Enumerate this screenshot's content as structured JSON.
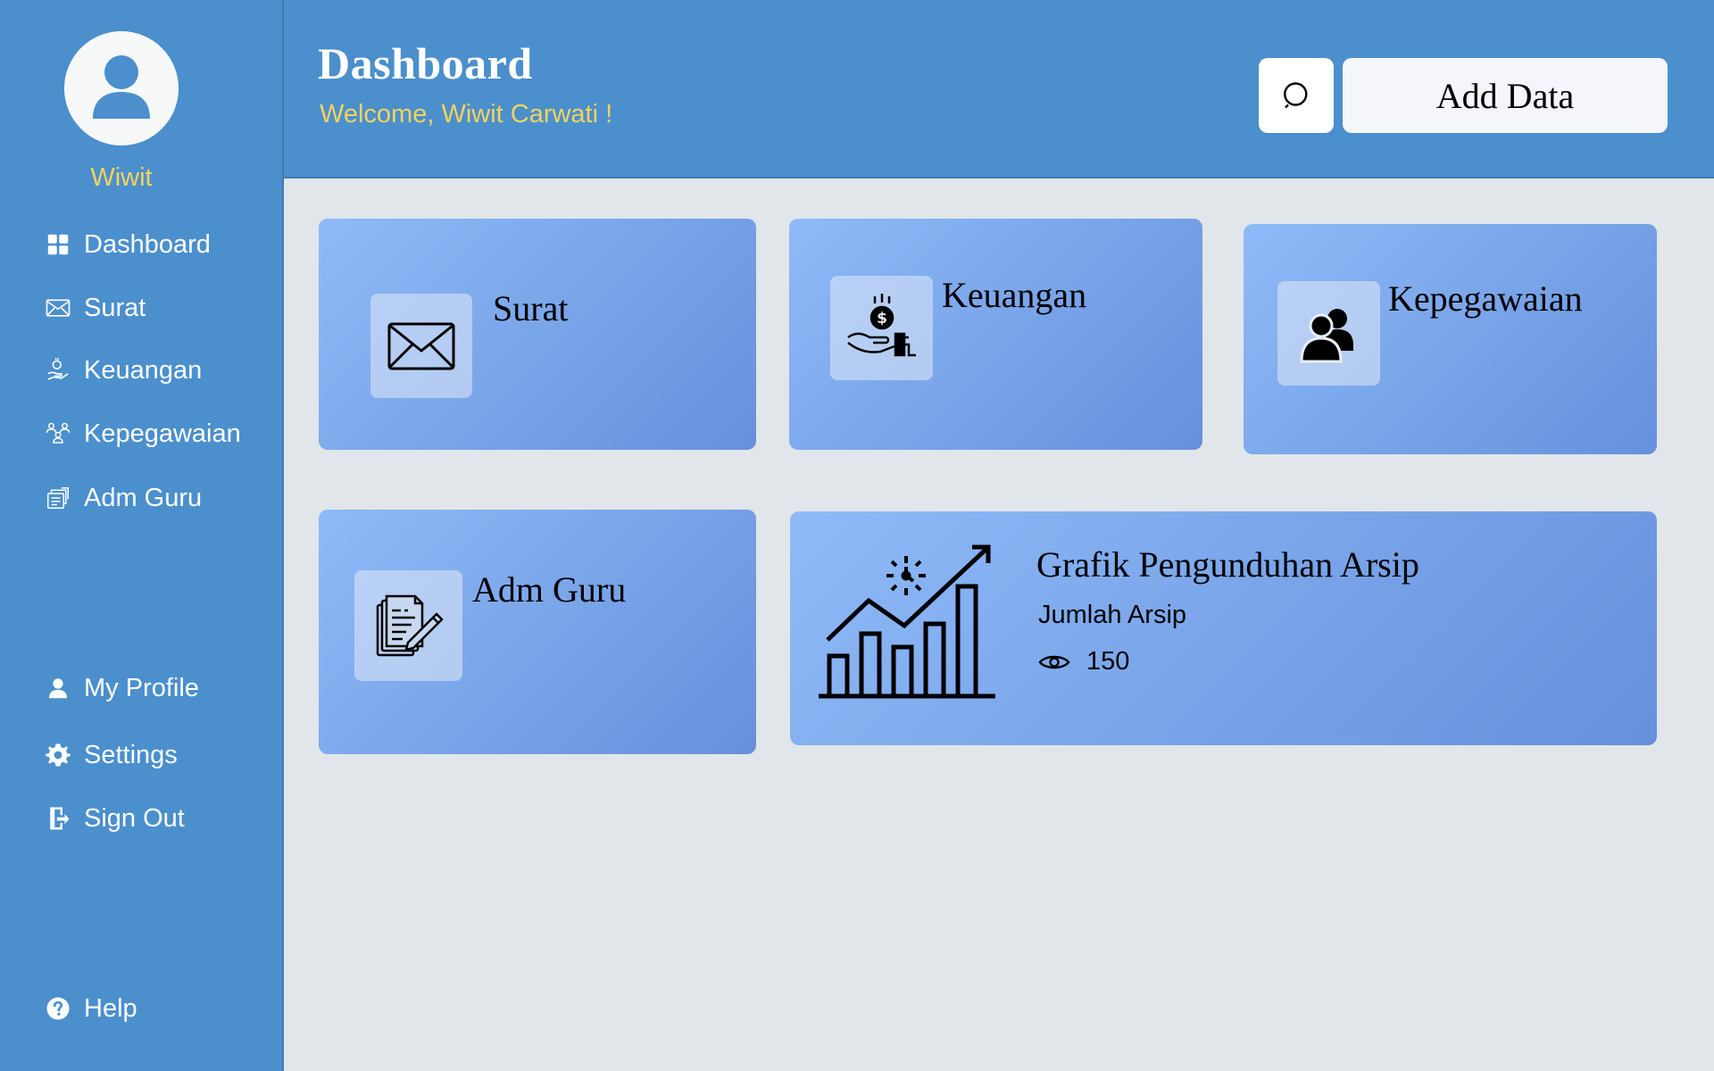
{
  "user": {
    "name": "Wiwit",
    "avatar_icon": "user-avatar-icon"
  },
  "sidebar": {
    "items": [
      {
        "label": "Dashboard",
        "icon": "dashboard-grid-icon"
      },
      {
        "label": "Surat",
        "icon": "envelope-icon"
      },
      {
        "label": "Keuangan",
        "icon": "money-hand-icon"
      },
      {
        "label": "Kepegawaian",
        "icon": "team-icon"
      },
      {
        "label": "Adm Guru",
        "icon": "documents-icon"
      }
    ],
    "bottom_items": [
      {
        "label": "My Profile",
        "icon": "person-icon"
      },
      {
        "label": "Settings",
        "icon": "gear-icon"
      },
      {
        "label": "Sign Out",
        "icon": "door-exit-icon"
      }
    ],
    "help": {
      "label": "Help",
      "icon": "question-circle-icon"
    }
  },
  "header": {
    "title": "Dashboard",
    "welcome": "Welcome, Wiwit Carwati !",
    "search_icon": "search-icon",
    "add_button": "Add Data"
  },
  "cards": [
    {
      "title": "Surat",
      "icon": "envelope-icon"
    },
    {
      "title": "Keuangan",
      "icon": "money-hand-icon"
    },
    {
      "title": "Kepegawaian",
      "icon": "users-icon"
    },
    {
      "title": "Adm Guru",
      "icon": "documents-pen-icon"
    }
  ],
  "stats_card": {
    "title": "Grafik Pengunduhan Arsip",
    "label": "Jumlah Arsip",
    "count": "150",
    "chart_icon": "growth-chart-icon",
    "view_icon": "eye-icon"
  },
  "colors": {
    "primary": "#4b8fcd",
    "accent_yellow": "#f3d35d",
    "background": "#e1e6ea",
    "card_gradient_start": "#8fbaf8",
    "card_gradient_end": "#6790dc"
  }
}
